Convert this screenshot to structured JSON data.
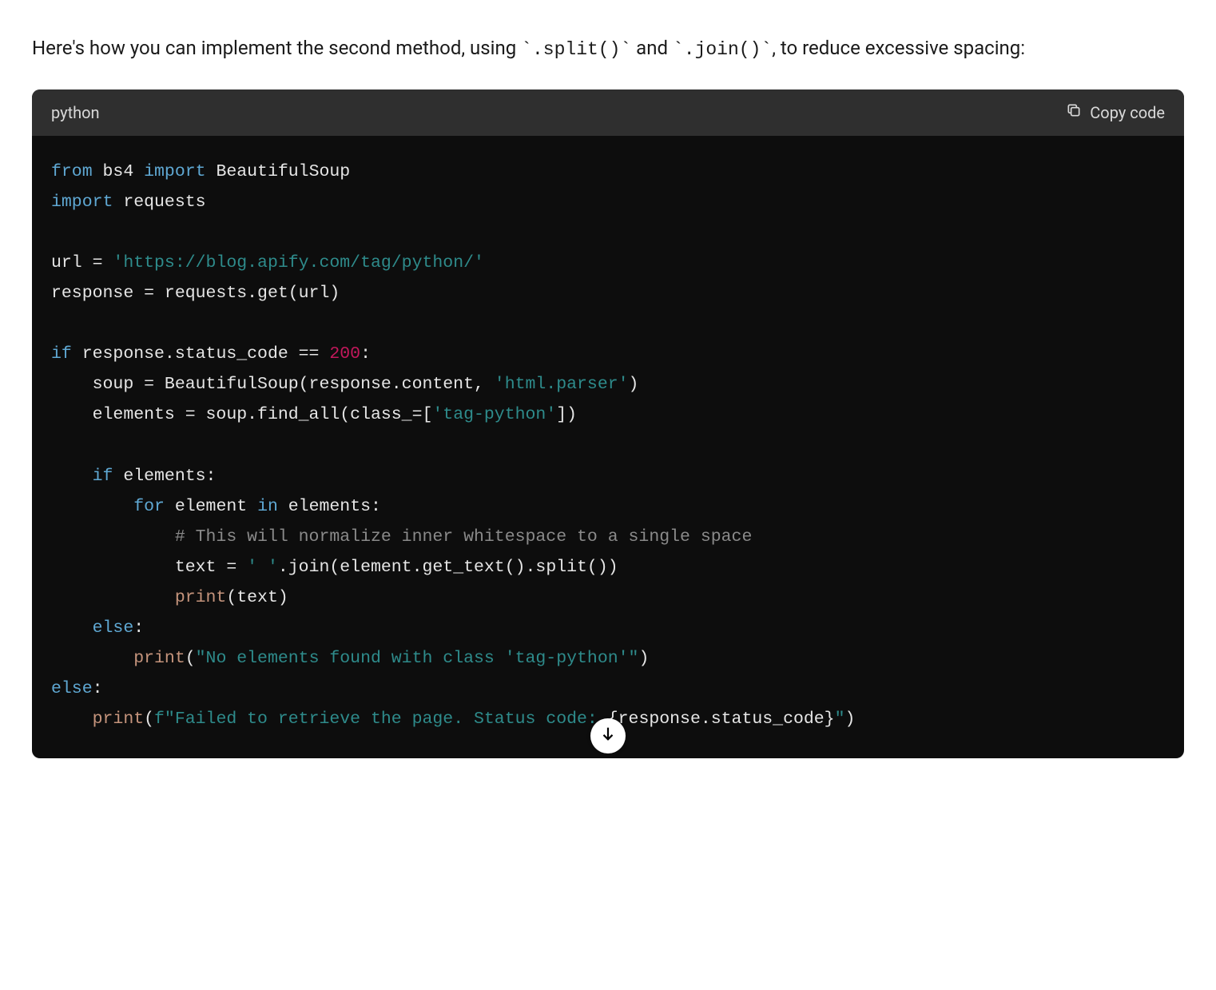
{
  "intro": {
    "pre": "Here's how you can implement the second method, using ",
    "inline1": "`.split()`",
    "mid": " and ",
    "inline2": "`.join()`",
    "post": ", to reduce excessive spacing:"
  },
  "codeHeader": {
    "language": "python",
    "copyLabel": "Copy code"
  },
  "code": {
    "l1_from": "from",
    "l1_bs4": " bs4 ",
    "l1_import": "import",
    "l1_BS": " BeautifulSoup",
    "l2_import": "import",
    "l2_req": " requests",
    "l4_url_eq": "url = ",
    "l4_str": "'https://blog.apify.com/tag/python/'",
    "l5": "response = requests.get(url)",
    "l7_if": "if",
    "l7_rest": " response.status_code == ",
    "l7_num": "200",
    "l7_colon": ":",
    "l8_pre": "    soup = BeautifulSoup(response.content, ",
    "l8_str": "'html.parser'",
    "l8_post": ")",
    "l9_pre": "    elements = soup.find_all(class_=[",
    "l9_str": "'tag-python'",
    "l9_post": "])",
    "l11_indent": "    ",
    "l11_if": "if",
    "l11_rest": " elements:",
    "l12_indent": "        ",
    "l12_for": "for",
    "l12_mid": " element ",
    "l12_in": "in",
    "l12_rest": " elements:",
    "l13_indent": "            ",
    "l13_cm": "# This will normalize inner whitespace to a single space",
    "l14_indent": "            text = ",
    "l14_str": "' '",
    "l14_post": ".join(element.get_text().split())",
    "l15_indent": "            ",
    "l15_print": "print",
    "l15_post": "(text)",
    "l16_indent": "    ",
    "l16_else": "else",
    "l16_colon": ":",
    "l17_indent": "        ",
    "l17_print": "print",
    "l17_open": "(",
    "l17_str": "\"No elements found with class 'tag-python'\"",
    "l17_close": ")",
    "l18_else": "else",
    "l18_colon": ":",
    "l19_indent": "    ",
    "l19_print": "print",
    "l19_open": "(",
    "l19_f": "f\"Failed to retrieve the page. Status code: ",
    "l19_interp": "{response.status_code}",
    "l19_end": "\"",
    "l19_close": ")"
  }
}
